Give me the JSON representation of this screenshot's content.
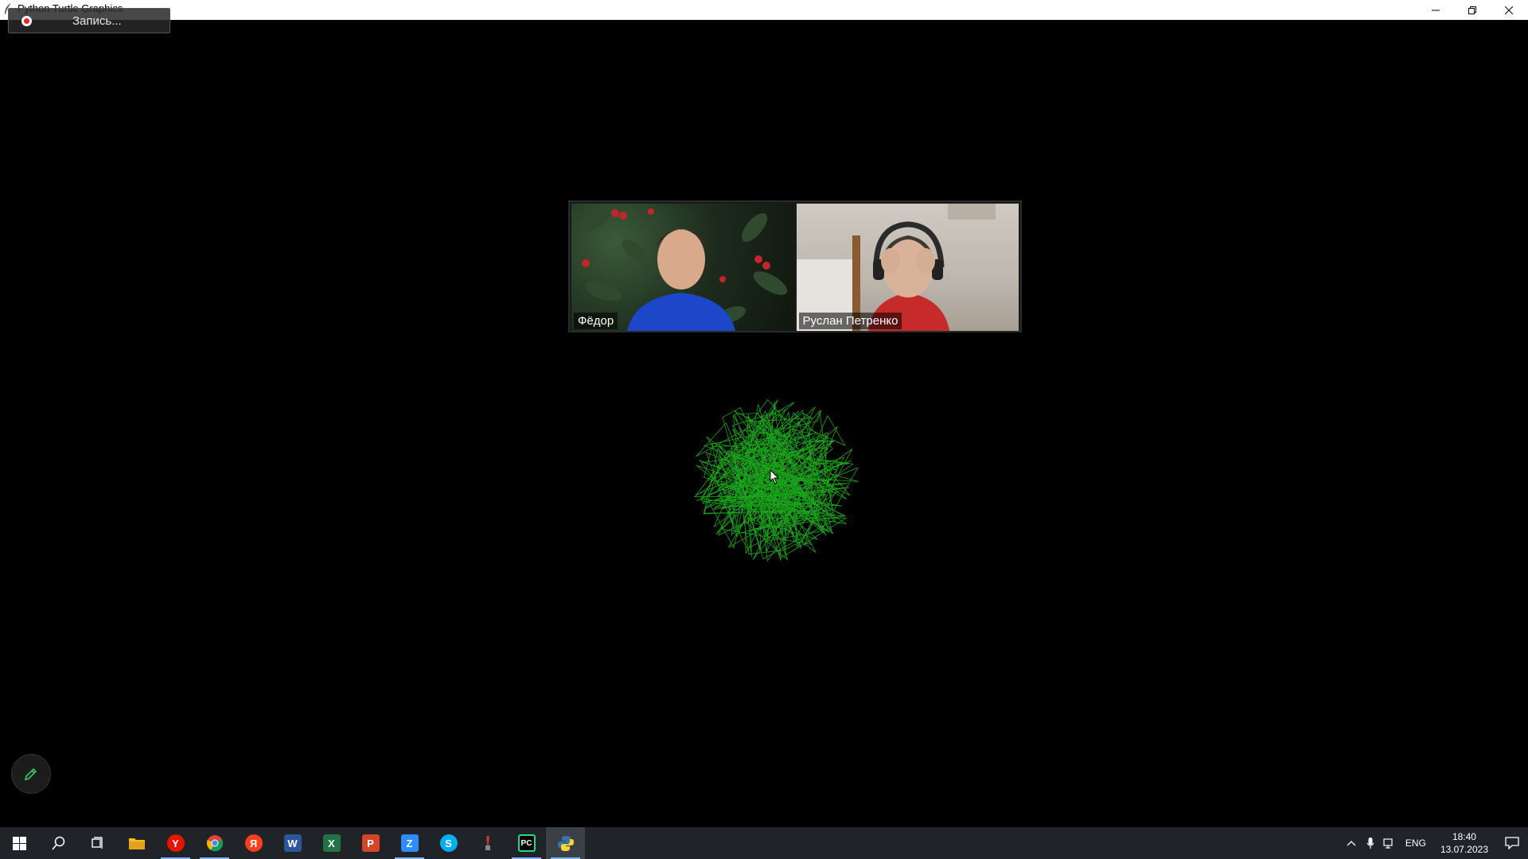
{
  "window": {
    "title": "Python Turtle Graphics",
    "icon": "feather-icon",
    "controls": [
      "minimize-icon",
      "restore-icon",
      "close-icon"
    ]
  },
  "recording": {
    "label": "Запись..."
  },
  "video": {
    "participants": [
      {
        "name": "Фёдор"
      },
      {
        "name": "Руслан Петренко"
      }
    ]
  },
  "drawing": {
    "description_color": "#19a319"
  },
  "annotate": {
    "icon": "pencil-icon",
    "color": "#33cc66"
  },
  "taskbar": {
    "items": [
      {
        "icon": "windows-start-icon"
      },
      {
        "icon": "search-icon"
      },
      {
        "icon": "task-view-icon"
      },
      {
        "icon": "file-explorer-icon",
        "color": "#f1c21b"
      },
      {
        "icon": "yandex-browser-icon",
        "color": "#e61400",
        "glyph": "Y"
      },
      {
        "icon": "chrome-icon"
      },
      {
        "icon": "yandex-icon",
        "color": "#fc3f1d",
        "glyph": "Я"
      },
      {
        "icon": "word-icon",
        "color": "#2b579a",
        "glyph": "W"
      },
      {
        "icon": "excel-icon",
        "color": "#217346",
        "glyph": "X"
      },
      {
        "icon": "powerpoint-icon",
        "color": "#d24726",
        "glyph": "P"
      },
      {
        "icon": "zoom-icon",
        "color": "#2d8cff",
        "glyph": "Z"
      },
      {
        "icon": "skype-icon",
        "color": "#00aff0",
        "glyph": "S"
      },
      {
        "icon": "paint-icon"
      },
      {
        "icon": "pycharm-icon",
        "glyph": "PC"
      },
      {
        "icon": "python-icon"
      }
    ],
    "tray": {
      "lang": "ENG",
      "time": "18:40",
      "date": "13.07.2023"
    }
  }
}
